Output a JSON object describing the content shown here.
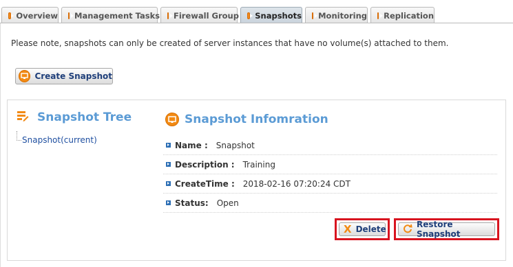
{
  "tabs": [
    {
      "label": "Overview",
      "active": false
    },
    {
      "label": "Management Tasks",
      "active": false
    },
    {
      "label": "Firewall Group",
      "active": false
    },
    {
      "label": "Snapshots",
      "active": true
    },
    {
      "label": "Monitoring",
      "active": false
    },
    {
      "label": "Replication",
      "active": false
    }
  ],
  "note": "Please note, snapshots can only be created of server instances that have no volume(s) attached to them.",
  "create_button": "Create Snapshot",
  "tree": {
    "title": "Snapshot Tree",
    "nodes": [
      "Snapshot(current)"
    ]
  },
  "info": {
    "title": "Snapshot Infomration",
    "rows": [
      {
        "label": "Name :",
        "value": "Snapshot"
      },
      {
        "label": "Description :",
        "value": "Training"
      },
      {
        "label": "CreateTime :",
        "value": "2018-02-16 07:20:24 CDT"
      },
      {
        "label": "Status:",
        "value": "Open"
      }
    ]
  },
  "actions": {
    "delete": "Delete",
    "restore": "Restore Snapshot"
  },
  "colors": {
    "accent_orange": "#f28a14",
    "title_blue": "#5b9bd5",
    "highlight_red": "#d8141f"
  }
}
